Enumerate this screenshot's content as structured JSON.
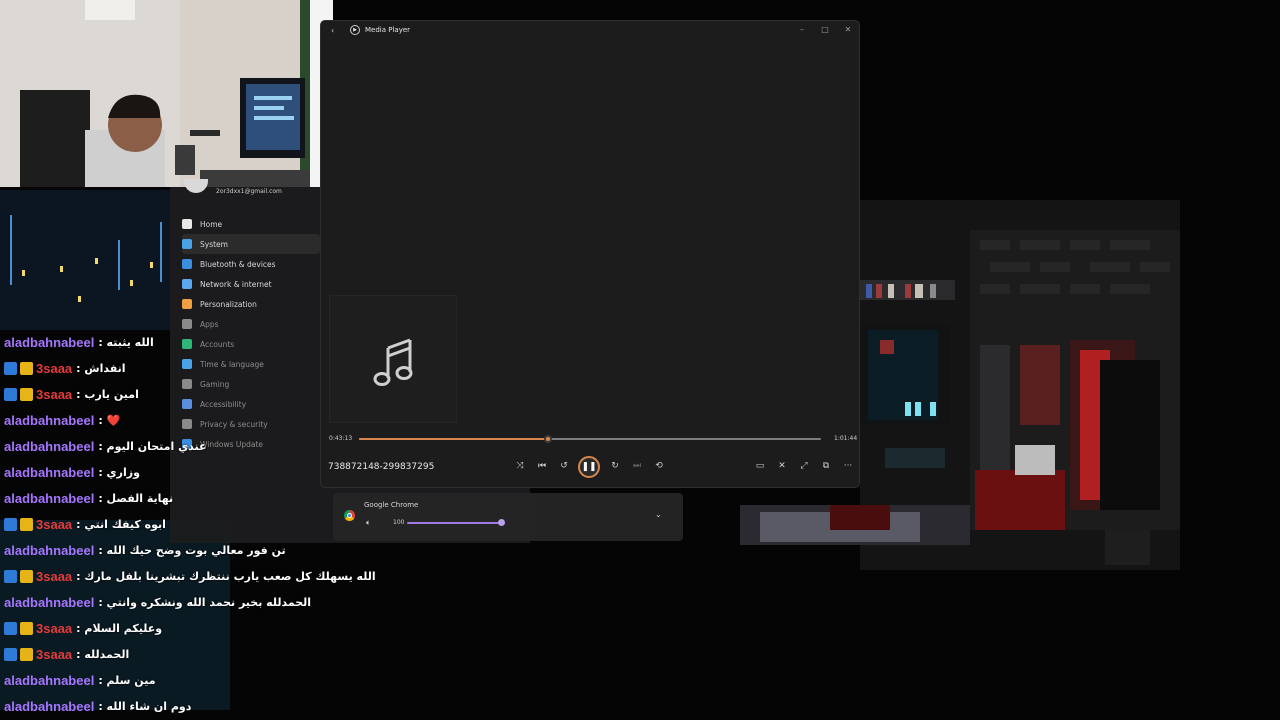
{
  "player": {
    "title": "Media Player",
    "icon": "media-player-icon",
    "elapsed": "0:43:13",
    "total": "1:01:44",
    "progress": 0.41,
    "track_name": "738872148-299837295",
    "accent_color": "#d7874e",
    "controls": [
      "shuffle-icon",
      "previous-icon",
      "rewind-10-icon",
      "pause-icon",
      "forward-30-icon",
      "next-icon",
      "repeat-icon"
    ],
    "right_controls": [
      "miniplayer-icon",
      "mute-icon",
      "fullscreen-icon",
      "cast-icon",
      "more-icon"
    ],
    "more_label": "···"
  },
  "settings": {
    "email": "2or3dxx1@gmail.com",
    "items": [
      {
        "label": "Home",
        "icon": "home-icon"
      },
      {
        "label": "System",
        "icon": "system-icon"
      },
      {
        "label": "Bluetooth & devices",
        "icon": "bluetooth-icon"
      },
      {
        "label": "Network & internet",
        "icon": "wifi-icon"
      },
      {
        "label": "Personalization",
        "icon": "brush-icon"
      },
      {
        "label": "Apps",
        "icon": "apps-icon"
      },
      {
        "label": "Accounts",
        "icon": "accounts-icon"
      },
      {
        "label": "Time & language",
        "icon": "globe-icon"
      },
      {
        "label": "Gaming",
        "icon": "gaming-icon"
      },
      {
        "label": "Accessibility",
        "icon": "accessibility-icon"
      },
      {
        "label": "Privacy & security",
        "icon": "shield-icon"
      },
      {
        "label": "Windows Update",
        "icon": "update-icon"
      }
    ]
  },
  "volume": {
    "app": "Google Chrome",
    "level_label": "100",
    "level": 1.0
  },
  "chat": {
    "messages": [
      {
        "user": "aladbahnabeel",
        "color": "#a676ff",
        "badges": [],
        "text": ": الله يثبته"
      },
      {
        "user": "3saaa",
        "color": "#e33b3b",
        "badges": [
          "mod",
          "crown"
        ],
        "text": ": انفداش"
      },
      {
        "user": "3saaa",
        "color": "#e33b3b",
        "badges": [
          "mod",
          "crown"
        ],
        "text": ": امين يارب"
      },
      {
        "user": "aladbahnabeel",
        "color": "#a676ff",
        "badges": [],
        "text": ": ❤️"
      },
      {
        "user": "aladbahnabeel",
        "color": "#a676ff",
        "badges": [],
        "text": ": عندي امتحان اليوم"
      },
      {
        "user": "aladbahnabeel",
        "color": "#a676ff",
        "badges": [],
        "text": ": وزاري"
      },
      {
        "user": "aladbahnabeel",
        "color": "#a676ff",
        "badges": [],
        "text": ": نهاية الفصل"
      },
      {
        "user": "3saaa",
        "color": "#e33b3b",
        "badges": [
          "mod",
          "crown"
        ],
        "text": ": ابوه كيفك انتي"
      },
      {
        "user": "aladbahnabeel",
        "color": "#a676ff",
        "badges": [],
        "text": ": تن فور معالي بوت وضح حيك الله"
      },
      {
        "user": "3saaa",
        "color": "#e33b3b",
        "badges": [
          "mod",
          "crown"
        ],
        "text": ": الله يسهلك كل صعب يارب ننتظرك تبشرينا بلفل مارك"
      },
      {
        "user": "aladbahnabeel",
        "color": "#a676ff",
        "badges": [],
        "text": ": الحمدلله بخير نحمد الله ونشكره وانتي"
      },
      {
        "user": "3saaa",
        "color": "#e33b3b",
        "badges": [
          "mod",
          "crown"
        ],
        "text": ": وعليكم السلام"
      },
      {
        "user": "3saaa",
        "color": "#e33b3b",
        "badges": [
          "mod",
          "crown"
        ],
        "text": ": الحمدلله"
      },
      {
        "user": "aladbahnabeel",
        "color": "#a676ff",
        "badges": [],
        "text": ": مين سلم"
      },
      {
        "user": "aladbahnabeel",
        "color": "#a676ff",
        "badges": [],
        "text": ": دوم ان شاء الله"
      }
    ]
  }
}
